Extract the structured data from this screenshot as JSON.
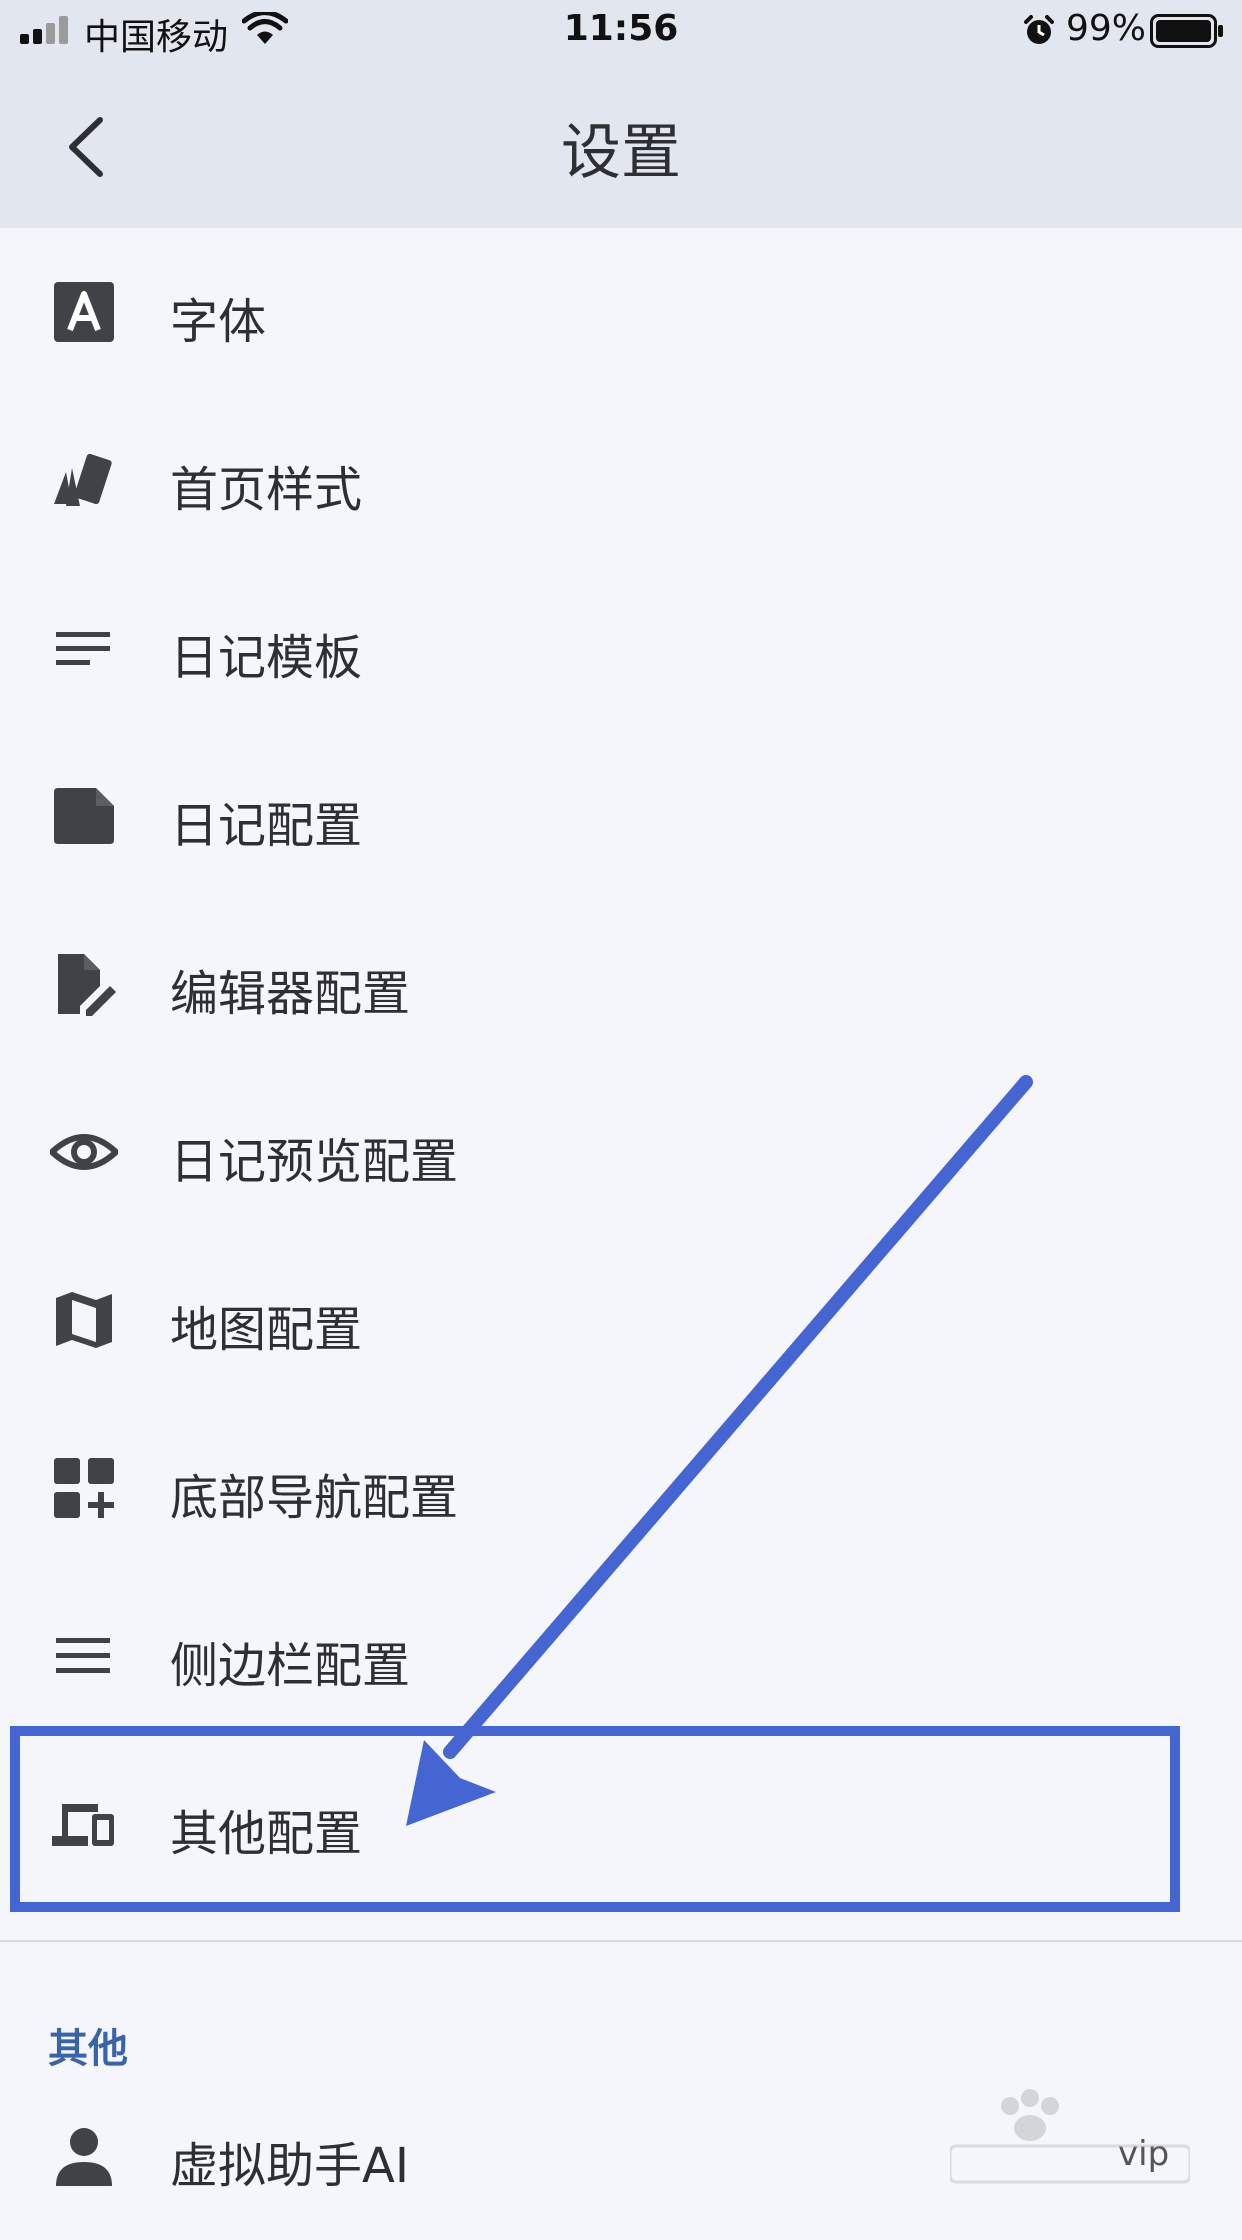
{
  "status_bar": {
    "carrier": "中国移动",
    "time": "11:56",
    "battery": "99%"
  },
  "nav": {
    "title": "设置"
  },
  "settings": [
    {
      "label": "字体",
      "icon": "font-icon"
    },
    {
      "label": "首页样式",
      "icon": "style-cards-icon"
    },
    {
      "label": "日记模板",
      "icon": "lines-icon"
    },
    {
      "label": "日记配置",
      "icon": "note-icon"
    },
    {
      "label": "编辑器配置",
      "icon": "edit-file-icon"
    },
    {
      "label": "日记预览配置",
      "icon": "eye-icon"
    },
    {
      "label": "地图配置",
      "icon": "map-icon"
    },
    {
      "label": "底部导航配置",
      "icon": "grid-add-icon"
    },
    {
      "label": "侧边栏配置",
      "icon": "menu-icon"
    },
    {
      "label": "其他配置",
      "icon": "devices-icon"
    }
  ],
  "other_section": {
    "header": "其他",
    "items": [
      {
        "label": "虚拟助手AI",
        "icon": "person-icon",
        "badge": "vip"
      }
    ]
  },
  "colors": {
    "accent": "#4565d3",
    "section_header": "#3a64a8",
    "bar_bg": "#e2e6ef",
    "page_bg": "#f5f6fb"
  }
}
